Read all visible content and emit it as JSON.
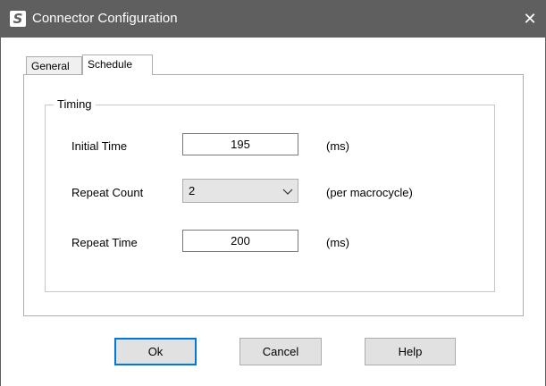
{
  "window": {
    "icon_letter": "S",
    "title": "Connector Configuration",
    "close_glyph": "✕"
  },
  "tabs": [
    {
      "label": "General",
      "active": false
    },
    {
      "label": "Schedule",
      "active": true
    }
  ],
  "timing_group": {
    "legend": "Timing",
    "initial_time": {
      "label": "Initial Time",
      "value": "195",
      "unit": "(ms)"
    },
    "repeat_count": {
      "label": "Repeat Count",
      "selected": "2",
      "unit": "(per macrocycle)"
    },
    "repeat_time": {
      "label": "Repeat Time",
      "value": "200",
      "unit": "(ms)"
    }
  },
  "buttons": {
    "ok": "Ok",
    "cancel": "Cancel",
    "help": "Help"
  },
  "colors": {
    "titlebar": "#5f5f5f",
    "focus_border": "#0078d7",
    "button_face": "#e1e1e1"
  },
  "icons": {
    "app": "app-s-icon",
    "close": "close-icon",
    "dropdown": "chevron-down-icon"
  }
}
